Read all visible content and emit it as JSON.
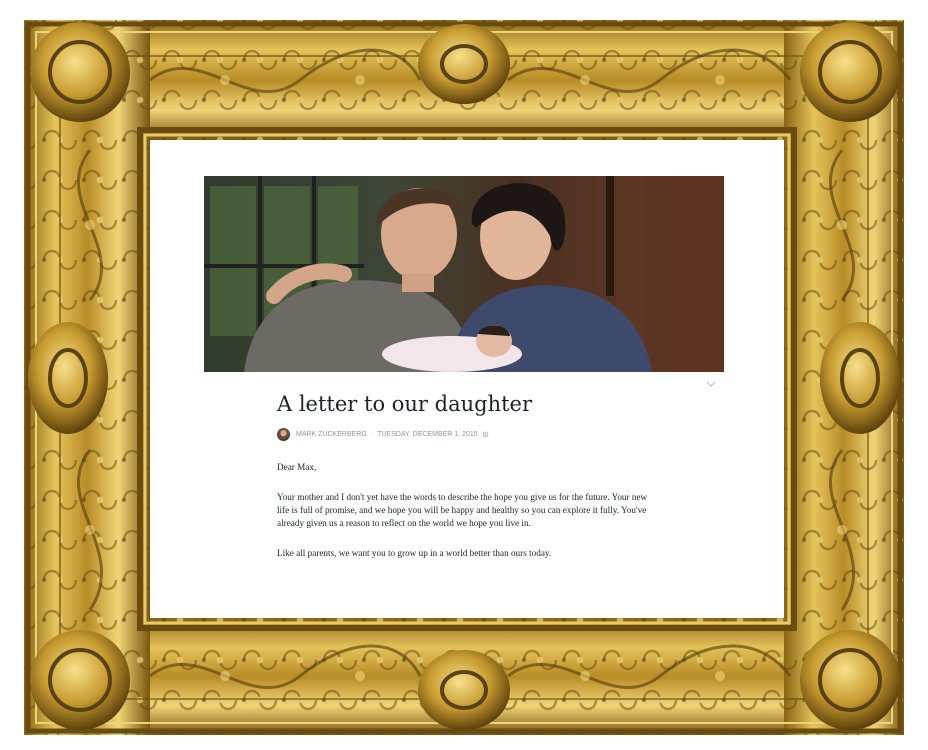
{
  "note": {
    "title": "A letter to our daughter",
    "author": "MARK ZUCKERBERG",
    "separator": "·",
    "date": "TUESDAY, DECEMBER 1, 2015",
    "icons": {
      "privacy": "globe-icon",
      "menu": "chevron-down-icon"
    },
    "greeting": "Dear Max,",
    "paragraphs": [
      "Your mother and I don't yet have the words to describe the hope you give us for the future. Your new life is full of promise, and we hope you will be happy and healthy so you can explore it fully. You've already given us a reason to reflect on the world we hope you live in.",
      "Like all parents, we want you to grow up in a world better than ours today."
    ]
  },
  "colors": {
    "frame_gold": "#c9a23a",
    "frame_dark": "#5a4210",
    "title_text": "#1d2129",
    "meta_text": "#90949c"
  }
}
